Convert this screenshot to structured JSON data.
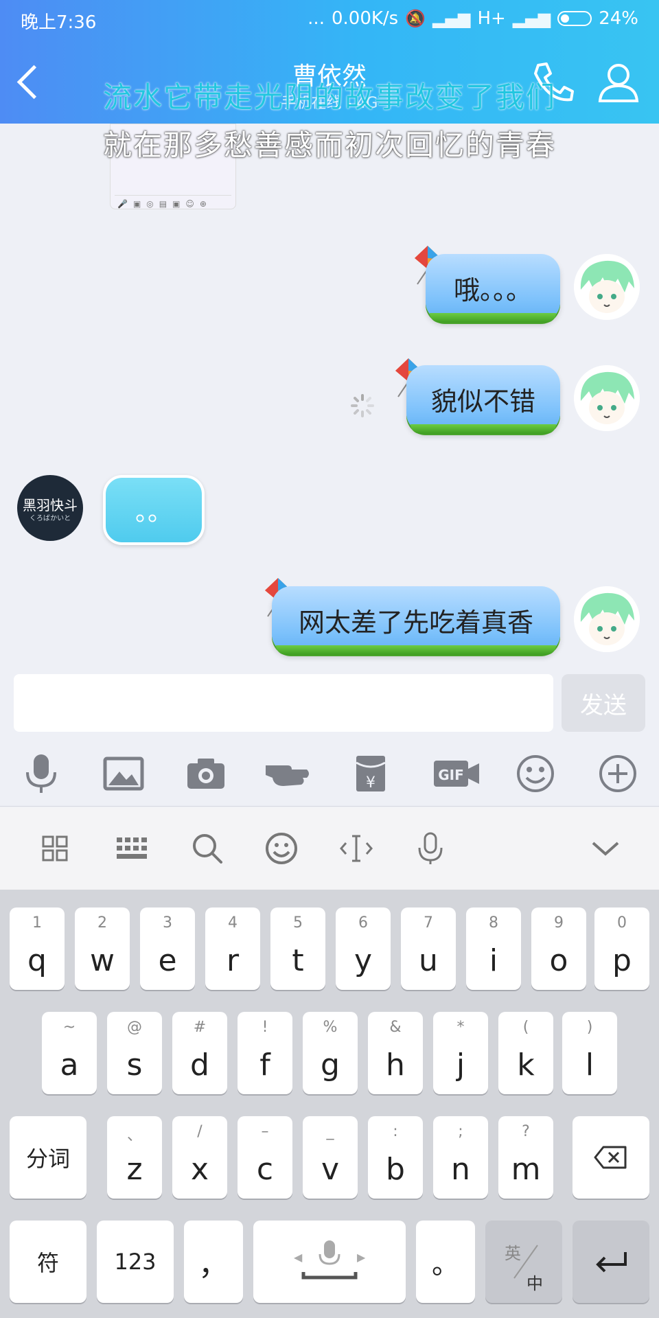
{
  "status_bar": {
    "time": "晚上7:36",
    "dots": "...",
    "speed": "0.00K/s",
    "network": "H+",
    "battery": "24%"
  },
  "header": {
    "title": "曹依然",
    "subtitle": "手机在线 - 4G"
  },
  "lyrics": {
    "line1": "流水它带走光阴的故事改变了我们",
    "line2": "就在那多愁善感而初次回忆的青春"
  },
  "messages": [
    {
      "side": "out",
      "text": "哦。。。"
    },
    {
      "side": "out",
      "text": "貌似不错"
    },
    {
      "side": "in",
      "text": "。。"
    },
    {
      "side": "out",
      "text": "网太差了先吃着真香"
    }
  ],
  "contact_avatar_text": "黑羽快斗",
  "contact_avatar_subtext": "くろばかいと",
  "input": {
    "placeholder": "",
    "send_label": "发送"
  },
  "toolbar_icons": [
    "microphone-icon",
    "image-icon",
    "camera-icon",
    "poke-icon",
    "red-packet-icon",
    "gif-icon",
    "emoji-icon",
    "plus-icon"
  ],
  "ime_bar_icons": [
    "grid-icon",
    "keyboard-icon",
    "search-icon",
    "emoji-icon",
    "cursor-icon",
    "voice-icon",
    "collapse-icon"
  ],
  "keyboard": {
    "row1": [
      {
        "main": "q",
        "sub": "1"
      },
      {
        "main": "w",
        "sub": "2"
      },
      {
        "main": "e",
        "sub": "3"
      },
      {
        "main": "r",
        "sub": "4"
      },
      {
        "main": "t",
        "sub": "5"
      },
      {
        "main": "y",
        "sub": "6"
      },
      {
        "main": "u",
        "sub": "7"
      },
      {
        "main": "i",
        "sub": "8"
      },
      {
        "main": "o",
        "sub": "9"
      },
      {
        "main": "p",
        "sub": "0"
      }
    ],
    "row2": [
      {
        "main": "a",
        "sub": "~"
      },
      {
        "main": "s",
        "sub": "@"
      },
      {
        "main": "d",
        "sub": "#"
      },
      {
        "main": "f",
        "sub": "!"
      },
      {
        "main": "g",
        "sub": "%"
      },
      {
        "main": "h",
        "sub": "&"
      },
      {
        "main": "j",
        "sub": "*"
      },
      {
        "main": "k",
        "sub": "("
      },
      {
        "main": "l",
        "sub": ")"
      }
    ],
    "row3": [
      {
        "main": "z",
        "sub": "、"
      },
      {
        "main": "x",
        "sub": "/"
      },
      {
        "main": "c",
        "sub": "–"
      },
      {
        "main": "v",
        "sub": "_"
      },
      {
        "main": "b",
        "sub": ":"
      },
      {
        "main": "n",
        "sub": ";"
      },
      {
        "main": "m",
        "sub": "?"
      }
    ],
    "segment_label": "分词",
    "symbol_label": "符",
    "numbers_label": "123",
    "comma": "，",
    "period": "。",
    "lang_top": "英",
    "lang_bottom": "中"
  }
}
